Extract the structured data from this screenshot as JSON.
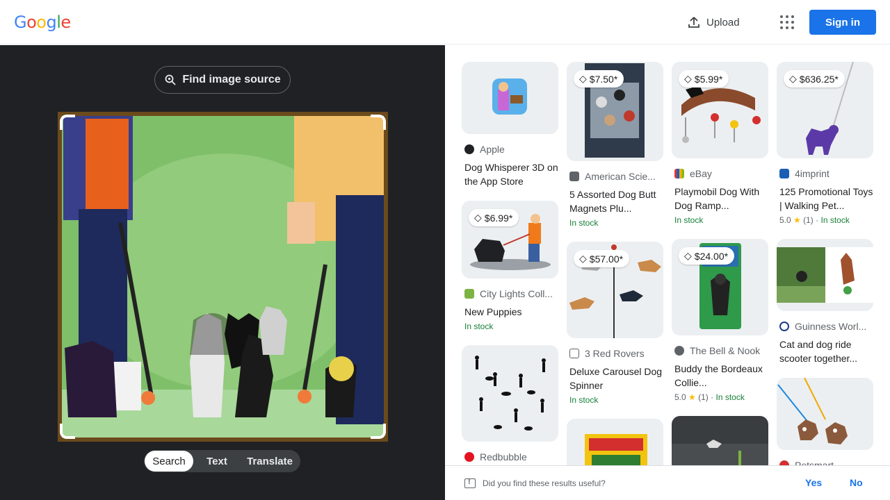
{
  "header": {
    "logo": "Google",
    "upload_label": "Upload",
    "signin_label": "Sign in"
  },
  "lens": {
    "find_source_label": "Find image source",
    "tabs": [
      "Search",
      "Text",
      "Translate"
    ],
    "active_tab": "Search"
  },
  "results": {
    "col1": [
      {
        "source": "Apple",
        "title": "Dog Whisperer 3D on the App Store",
        "price": "",
        "meta": ""
      },
      {
        "source": "City Lights Coll...",
        "title": "New Puppies",
        "price": "$6.99*",
        "meta": "In stock"
      },
      {
        "source": "Redbubble",
        "title": "",
        "price": "",
        "meta": ""
      }
    ],
    "col2": [
      {
        "source": "American Scie...",
        "title": "5 Assorted Dog Butt Magnets Plu...",
        "price": "$7.50*",
        "meta": "In stock"
      },
      {
        "source": "3 Red Rovers",
        "title": "Deluxe Carousel Dog Spinner",
        "price": "$57.00*",
        "meta": "In stock"
      }
    ],
    "col3": [
      {
        "source": "eBay",
        "title": "Playmobil Dog With Dog Ramp...",
        "price": "$5.99*",
        "meta": "In stock"
      },
      {
        "source": "The Bell & Nook",
        "title": "Buddy the Bordeaux Collie...",
        "price": "$24.00*",
        "rating": "5.0",
        "reviews": "(1)",
        "meta": "In stock"
      }
    ],
    "col4": [
      {
        "source": "4imprint",
        "title": "125 Promotional Toys | Walking Pet...",
        "price": "$636.25*",
        "rating": "5.0",
        "reviews": "(1)",
        "meta": "In stock"
      },
      {
        "source": "Guinness Worl...",
        "title": "Cat and dog ride scooter together...",
        "price": "",
        "meta": ""
      }
    ],
    "col2_extra": "",
    "col4_extra": "Petsmart"
  },
  "feedback": {
    "question": "Did you find these results useful?",
    "yes": "Yes",
    "no": "No"
  },
  "colors": {
    "accent": "#1a73e8",
    "dark_panel": "#202124",
    "in_stock": "#188038"
  }
}
